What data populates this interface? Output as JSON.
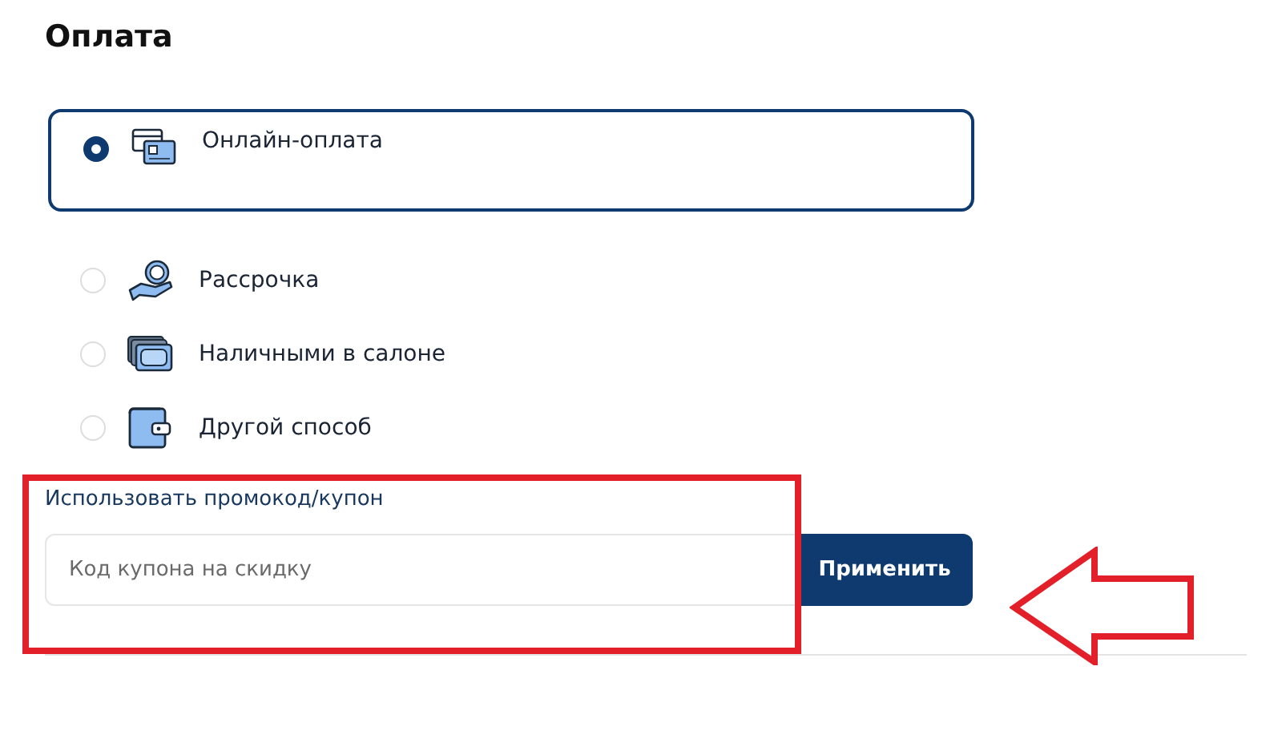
{
  "title": "Оплата",
  "options": [
    {
      "label": "Онлайн-оплата",
      "kind": "card",
      "selected": true
    },
    {
      "label": "Рассрочка",
      "kind": "coin",
      "selected": false
    },
    {
      "label": "Наличными в салоне",
      "kind": "cash",
      "selected": false
    },
    {
      "label": "Другой способ",
      "kind": "wallet",
      "selected": false
    }
  ],
  "promo": {
    "link": "Использовать промокод/купон",
    "placeholder": "Код купона на скидку",
    "button": "Применить"
  },
  "annotations": {
    "highlight_frame": true,
    "arrow": true
  }
}
